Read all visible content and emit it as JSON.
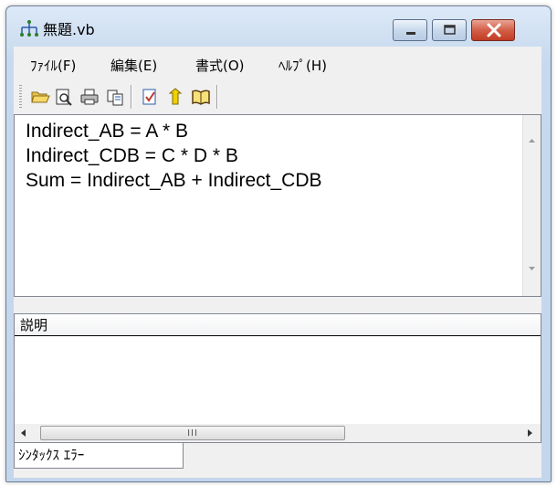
{
  "window": {
    "title": "無題.vb",
    "title_icon": "network-tree-icon"
  },
  "caption_buttons": [
    "minimize-icon",
    "maximize-icon",
    "close-icon"
  ],
  "menu": {
    "items": [
      {
        "label": "ﾌｧｲﾙ(F)"
      },
      {
        "label": "編集(E)"
      },
      {
        "label": "書式(O)"
      },
      {
        "label": "ﾍﾙﾌﾟ(H)"
      }
    ]
  },
  "toolbar": {
    "buttons": [
      "open-folder-icon",
      "print-preview-icon",
      "print-icon",
      "copy-icon",
      "check-document-icon",
      "arrow-icon",
      "book-icon"
    ]
  },
  "editor": {
    "lines": [
      "Indirect_AB = A * B",
      "Indirect_CDB = C * D * B",
      "Sum = Indirect_AB + Indirect_CDB"
    ]
  },
  "description": {
    "header": "説明",
    "scroll_thumb": "III"
  },
  "tabs": {
    "syntax_error": "ｼﾝﾀｯｸｽ ｴﾗｰ"
  },
  "colors": {
    "close_button": "#c03c23",
    "frame": "#c4d6ec"
  }
}
